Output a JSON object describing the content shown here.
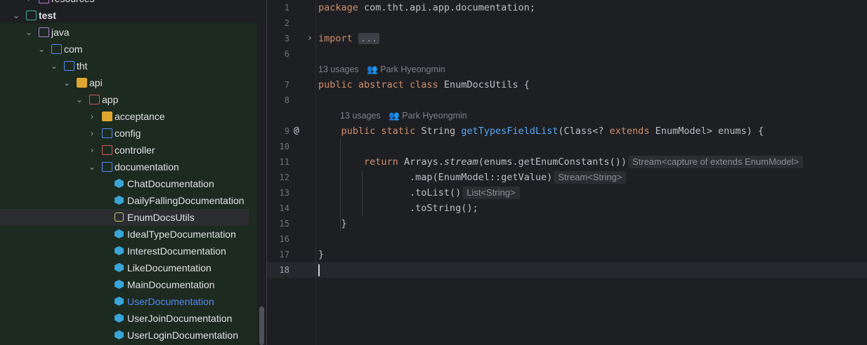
{
  "project_tree": {
    "items": [
      {
        "label": "resources",
        "depth": 2,
        "icon": "resources-folder-icon",
        "expanded": false
      },
      {
        "label": "test",
        "depth": 1,
        "icon": "test-folder-icon",
        "expanded": true
      },
      {
        "label": "java",
        "depth": 2,
        "icon": "java-source-folder-icon",
        "expanded": true
      },
      {
        "label": "com",
        "depth": 3,
        "icon": "package-folder-icon",
        "expanded": true
      },
      {
        "label": "tht",
        "depth": 4,
        "icon": "package-folder-icon",
        "expanded": true
      },
      {
        "label": "api",
        "depth": 5,
        "icon": "package-folder-icon",
        "expanded": true
      },
      {
        "label": "app",
        "depth": 6,
        "icon": "package-folder-icon",
        "expanded": true
      },
      {
        "label": "acceptance",
        "depth": 7,
        "icon": "package-folder-icon",
        "expanded": false
      },
      {
        "label": "config",
        "depth": 7,
        "icon": "package-folder-icon",
        "expanded": false
      },
      {
        "label": "controller",
        "depth": 7,
        "icon": "package-folder-icon",
        "expanded": false
      },
      {
        "label": "documentation",
        "depth": 7,
        "icon": "package-folder-icon",
        "expanded": true
      },
      {
        "label": "ChatDocumentation",
        "depth": 8,
        "icon": "class-icon"
      },
      {
        "label": "DailyFallingDocumentation",
        "depth": 8,
        "icon": "class-icon"
      },
      {
        "label": "EnumDocsUtils",
        "depth": 8,
        "icon": "abstract-class-icon",
        "selected": true
      },
      {
        "label": "IdealTypeDocumentation",
        "depth": 8,
        "icon": "class-icon"
      },
      {
        "label": "InterestDocumentation",
        "depth": 8,
        "icon": "class-icon"
      },
      {
        "label": "LikeDocumentation",
        "depth": 8,
        "icon": "class-icon"
      },
      {
        "label": "MainDocumentation",
        "depth": 8,
        "icon": "class-icon"
      },
      {
        "label": "UserDocumentation",
        "depth": 8,
        "icon": "class-icon",
        "modified": true
      },
      {
        "label": "UserJoinDocumentation",
        "depth": 8,
        "icon": "class-icon"
      },
      {
        "label": "UserLoginDocumentation",
        "depth": 8,
        "icon": "class-icon"
      }
    ]
  },
  "editor": {
    "line_numbers": [
      "1",
      "2",
      "3",
      "6",
      "7",
      "8",
      "9",
      "10",
      "11",
      "12",
      "13",
      "14",
      "15",
      "16",
      "17",
      "18"
    ],
    "current_line": "18",
    "lens_class_usages": "13 usages",
    "lens_class_author": "Park Hyeongmin",
    "lens_method_usages": "13 usages",
    "lens_method_author": "Park Hyeongmin",
    "hint_stream": "Stream<capture of extends EnumModel>",
    "hint_map": "Stream<String>",
    "hint_list": "List<String>",
    "import_fold": "..."
  },
  "colors": {
    "keyword": "#cf8e6d",
    "method": "#56a8f5",
    "text": "#bcbec4",
    "modified_file": "#548af7"
  }
}
